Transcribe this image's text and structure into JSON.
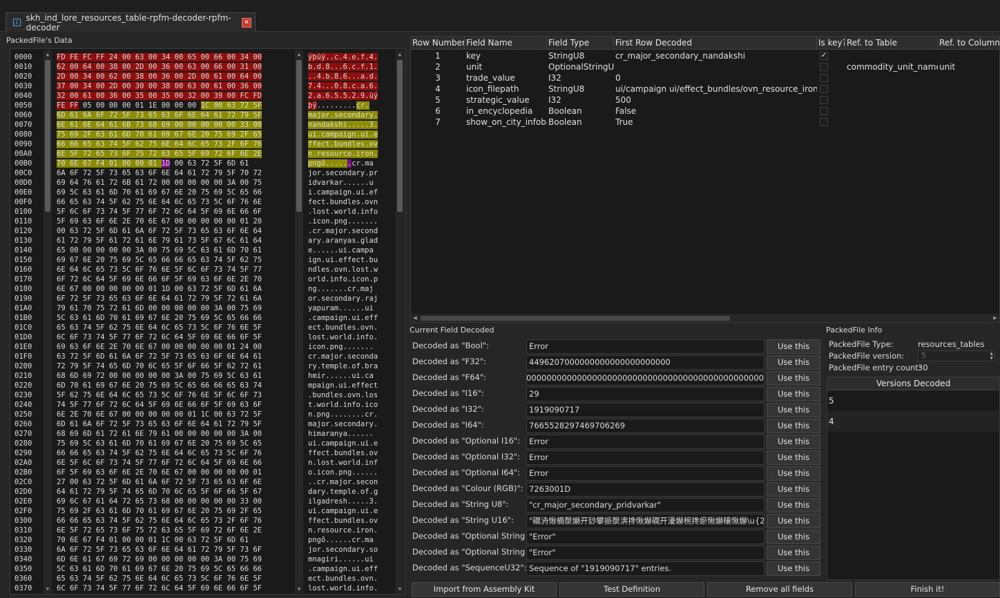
{
  "tab": {
    "title": "skh_ind_lore_resources_table-rpfm-decoder-rpfm-decoder",
    "icon": "file-icon"
  },
  "hex_panel": {
    "title": "PackedFile's Data",
    "offsets": [
      "0000",
      "0010",
      "0020",
      "0030",
      "0040",
      "0050",
      "0060",
      "0070",
      "0080",
      "0090",
      "00A0",
      "00B0",
      "00C0",
      "00D0",
      "00E0",
      "00F0",
      "0100",
      "0110",
      "0120",
      "0130",
      "0140",
      "0150",
      "0160",
      "0170",
      "0180",
      "0190",
      "01A0",
      "01B0",
      "01C0",
      "01D0",
      "01E0",
      "01F0",
      "0200",
      "0210",
      "0220",
      "0230",
      "0240",
      "0250",
      "0260",
      "0270",
      "0280",
      "0290",
      "02A0",
      "02B0",
      "02C0",
      "02D0",
      "02E0",
      "02F0",
      "0300",
      "0310",
      "0320",
      "0330",
      "0340",
      "0350",
      "0360",
      "0370"
    ],
    "hex_lines": [
      "FD FE FC FF 24 00 63 00 34 00 65 00 66 00 34 00",
      "62 00 64 00 38 00 2D 00 36 00 63 00 66 00 31 00",
      "2D 00 34 00 62 00 38 00 36 00 2D 00 61 00 64 00",
      "37 00 34 00 2D 00 30 00 38 00 63 00 61 00 36 00",
      "32 00 61 00 36 00 35 00 35 00 32 00 39 00 FC FD",
      "FE FF 05 00 00 00 01 1E 00 00 00 1C 00 63 72 5F",
      "6D 61 6A 6F 72 5F 73 65 63 6F 6E 64 61 72 79 5F",
      "6E 61 6E 64 61 6B 73 68 69 00 00 00 00 00 33 00",
      "75 69 2F 63 61 6D 70 61 69 67 6E 20 75 69 2F 65",
      "66 66 65 63 74 5F 62 75 6E 64 6C 65 73 2F 6F 76",
      "6E 5F 72 65 73 6F 75 72 63 65 5F 69 72 6F 6E 2E",
      "70 6E 67 F4 01 00 00 01 1D 00 63 72 5F 6D 61",
      "6A 6F 72 5F 73 65 63 6F 6E 64 61 72 79 5F 70 72",
      "69 64 76 61 72 6B 61 72 00 00 00 00 00 3A 00 75",
      "69 5C 63 61 6D 70 61 69 67 6E 20 75 69 5C 65 66",
      "66 65 63 74 5F 62 75 6E 64 6C 65 73 5C 6F 76 6E",
      "5F 6C 6F 73 74 5F 77 6F 72 6C 64 5F 69 6E 66 6F",
      "5F 69 63 6F 6E 2E 70 6E 67 00 00 00 00 00 01 20",
      "00 63 72 5F 6D 61 6A 6F 72 5F 73 65 63 6F 6E 64",
      "61 72 79 5F 61 72 61 6E 79 61 73 5F 67 6C 61 64",
      "65 00 00 00 00 00 3A 00 75 69 5C 63 61 6D 70 61",
      "69 67 6E 20 75 69 5C 65 66 66 65 63 74 5F 62 75",
      "6E 64 6C 65 73 5C 6F 76 6E 5F 6C 6F 73 74 5F 77",
      "6F 72 6C 64 5F 69 6E 66 6F 5F 69 63 6F 6E 2E 70",
      "6E 67 00 00 00 00 00 01 1D 00 63 72 5F 6D 61 6A",
      "6F 72 5F 73 65 63 6F 6E 64 61 72 79 5F 72 61 6A",
      "79 61 70 75 72 61 6D 00 00 00 00 00 3A 00 75 69",
      "5C 63 61 6D 70 61 69 67 6E 20 75 69 5C 65 66 66",
      "65 63 74 5F 62 75 6E 64 6C 65 73 5C 6F 76 6E 5F",
      "6C 6F 73 74 5F 77 6F 72 6C 64 5F 69 6E 66 6F 5F",
      "69 63 6F 6E 2E 70 6E 67 00 00 00 00 00 01 24 00",
      "63 72 5F 6D 61 6A 6F 72 5F 73 65 63 6F 6E 64 61",
      "72 79 5F 74 65 6D 70 6C 65 5F 6F 66 5F 62 72 61",
      "68 6D 69 72 00 00 00 00 00 3A 00 75 69 5C 63 61",
      "6D 70 61 69 67 6E 20 75 69 5C 65 66 66 65 63 74",
      "5F 62 75 6E 64 6C 65 73 5C 6F 76 6E 5F 6C 6F 73",
      "74 5F 77 6F 72 6C 64 5F 69 6E 66 6F 5F 69 63 6F",
      "6E 2E 70 6E 67 00 00 00 00 00 01 1C 00 63 72 5F",
      "6D 61 6A 6F 72 5F 73 65 63 6F 6E 64 61 72 79 5F",
      "68 69 6D 61 72 61 6E 79 61 00 00 00 00 00 3A 00",
      "75 69 5C 63 61 6D 70 61 69 67 6E 20 75 69 5C 65",
      "66 66 65 63 74 5F 62 75 6E 64 6C 65 73 5C 6F 76",
      "6E 5F 6C 6F 73 74 5F 77 6F 72 6C 64 5F 69 6E 66",
      "6F 5F 69 63 6F 6E 2E 70 6E 67 00 00 00 00 00 01",
      "27 00 63 72 5F 6D 61 6A 6F 72 5F 73 65 63 6F 6E",
      "64 61 72 79 5F 74 65 6D 70 6C 65 5F 6F 66 5F 67",
      "69 6C 67 61 64 72 65 73 68 00 00 00 00 00 33 00",
      "75 69 2F 63 61 6D 70 61 69 67 6E 20 75 69 2F 65",
      "66 66 65 63 74 5F 62 75 6E 64 6C 65 73 2F 6F 76",
      "6E 5F 72 65 73 6F 75 72 63 65 5F 69 72 6F 6E 2E",
      "70 6E 67 F4 01 00 00 01 1C 00 63 72 5F 6D 61",
      "6A 6F 72 5F 73 65 63 6F 6E 64 61 72 79 5F 73 6F",
      "6D 6E 61 67 69 72 69 00 00 00 00 00 3A 00 75 69",
      "5C 63 61 6D 70 61 69 67 6E 20 75 69 5C 65 66 66",
      "65 63 74 5F 62 75 6E 64 6C 65 73 5C 6F 76 6E 5F",
      "6C 6F 73 74 5F 77 6F 72 6C 64 5F 69 6E 66 6F 5F"
    ],
    "ascii_lines": [
      "ýþüÿ..c.4.e.f.4.",
      "b.d.8...6.c.f.1.",
      "..4.b.8.6...a.d.",
      "7.4...0.8.c.a.6.",
      "2.a.6.5.5.2.9.üý",
      "þÿ.........cr.",
      "major.secondary.",
      "nandakshi.....3.",
      "ui.campaign.ui.e",
      "ffect.bundles.ov",
      "n.resource.iron.",
      "pngô......cr.ma",
      "jor.secondary.pr",
      "idvarkar......u",
      "i.campaign.ui.ef",
      "fect.bundles.ovn",
      ".lost.world.info",
      ".icon.png.......",
      ".cr.major.second",
      "ary.aranyas.glad",
      "e......ui.campa",
      "ign.ui.effect.bu",
      "ndles.ovn.lost.w",
      "orld.info.icon.p",
      "ng.......cr.maj",
      "or.secondary.raj",
      "yapuram......ui",
      ".campaign.ui.eff",
      "ect.bundles.ovn.",
      "lost.world.info.",
      "icon.png.......",
      "cr.major.seconda",
      "ry.temple.of.bra",
      "hmir......ui.ca",
      "mpaign.ui.effect",
      ".bundles.ovn.los",
      "t.world.info.ico",
      "n.png........cr.",
      "major.secondary.",
      "himaranya......",
      "ui.campaign.ui.e",
      "ffect.bundles.ov",
      "n.lost.world.inf",
      "o.icon.png......",
      "..cr.major.secon",
      "dary.temple.of.g",
      "ilgadresh.....3.",
      "ui.campaign.ui.e",
      "ffect.bundles.ov",
      "n.resource.iron.",
      "pngô......cr.ma",
      "jor.secondary.so",
      "mnagiri......ui",
      ".campaign.ui.eff",
      "ect.bundles.ovn.",
      "lost.world.info."
    ]
  },
  "field_table": {
    "columns": [
      "Row Number",
      "Field Name",
      "Field Type",
      "First Row Decoded",
      "Is key?",
      "Ref. to Table",
      "Ref. to Column"
    ],
    "rows": [
      {
        "row": "1",
        "name": "key",
        "type": "StringU8",
        "first": "cr_major_secondary_nandakshi",
        "is_key": true,
        "ref_table": "",
        "ref_column": ""
      },
      {
        "row": "2",
        "name": "unit",
        "type": "OptionalStringU8",
        "first": "",
        "is_key": false,
        "ref_table": "commodity_unit_names",
        "ref_column": "unit"
      },
      {
        "row": "3",
        "name": "trade_value",
        "type": "I32",
        "first": "0",
        "is_key": false,
        "ref_table": "",
        "ref_column": ""
      },
      {
        "row": "4",
        "name": "icon_filepath",
        "type": "StringU8",
        "first": "ui/campaign ui/effect_bundles/ovn_resource_iron.png",
        "is_key": false,
        "ref_table": "",
        "ref_column": ""
      },
      {
        "row": "5",
        "name": "strategic_value",
        "type": "I32",
        "first": "500",
        "is_key": false,
        "ref_table": "",
        "ref_column": ""
      },
      {
        "row": "6",
        "name": "in_encyclopedia",
        "type": "Boolean",
        "first": "False",
        "is_key": false,
        "ref_table": "",
        "ref_column": ""
      },
      {
        "row": "7",
        "name": "show_on_city_infobar",
        "type": "Boolean",
        "first": "True",
        "is_key": false,
        "ref_table": "",
        "ref_column": ""
      }
    ]
  },
  "current_field": {
    "title": "Current Field Decoded",
    "button_label": "Use this",
    "rows": [
      {
        "label": "Decoded as \"Bool\":",
        "value": "Error"
      },
      {
        "label": "Decoded as \"F32\":",
        "value": "4496207000000000000000000000"
      },
      {
        "label": "Decoded as \"F64\":",
        "value": "00000000000000000000000000000000000000000000000000000000000000000000"
      },
      {
        "label": "Decoded as \"I16\":",
        "value": "29"
      },
      {
        "label": "Decoded as \"I32\":",
        "value": "1919090717"
      },
      {
        "label": "Decoded as \"I64\":",
        "value": "7665528297469706269"
      },
      {
        "label": "Decoded as \"Optional I16\":",
        "value": "Error"
      },
      {
        "label": "Decoded as \"Optional I32\":",
        "value": "Error"
      },
      {
        "label": "Decoded as \"Optional I64\":",
        "value": "Error"
      },
      {
        "label": "Decoded as \"Colour (RGB)\":",
        "value": "7263001D"
      },
      {
        "label": "Decoded as \"String U8\":",
        "value": "\"cr_major_secondary_pridvarkar\""
      },
      {
        "label": "Decoded as \"String U16\":",
        "value": "\"礀洀愀樀漀爀开猀攀挀漀渀搀愀爀礀开瀀爀椀搀瘀愀爀欀愀爀\\u{206e}楰渀\""
      },
      {
        "label": "Decoded as \"Optional String U8\":",
        "value": "\"Error\""
      },
      {
        "label": "Decoded as \"Optional String U16\":",
        "value": "\"Error\""
      },
      {
        "label": "Decoded as \"SequenceU32\":",
        "value": "Sequence of \"1919090717\" entries."
      }
    ]
  },
  "packedfile_info": {
    "title": "PackedFile Info",
    "type_label": "PackedFile Type:",
    "type_value": "resources_tables",
    "version_label": "PackedFile version:",
    "version_value": "5",
    "count_label": "PackedFile entry count:",
    "count_value": "30",
    "versions_header": "Versions Decoded",
    "versions": [
      "5",
      "4"
    ]
  },
  "bottom_buttons": {
    "import": "Import from Assembly Kit",
    "test": "Test Definition",
    "remove": "Remove all fields",
    "finish": "Finish it!"
  }
}
